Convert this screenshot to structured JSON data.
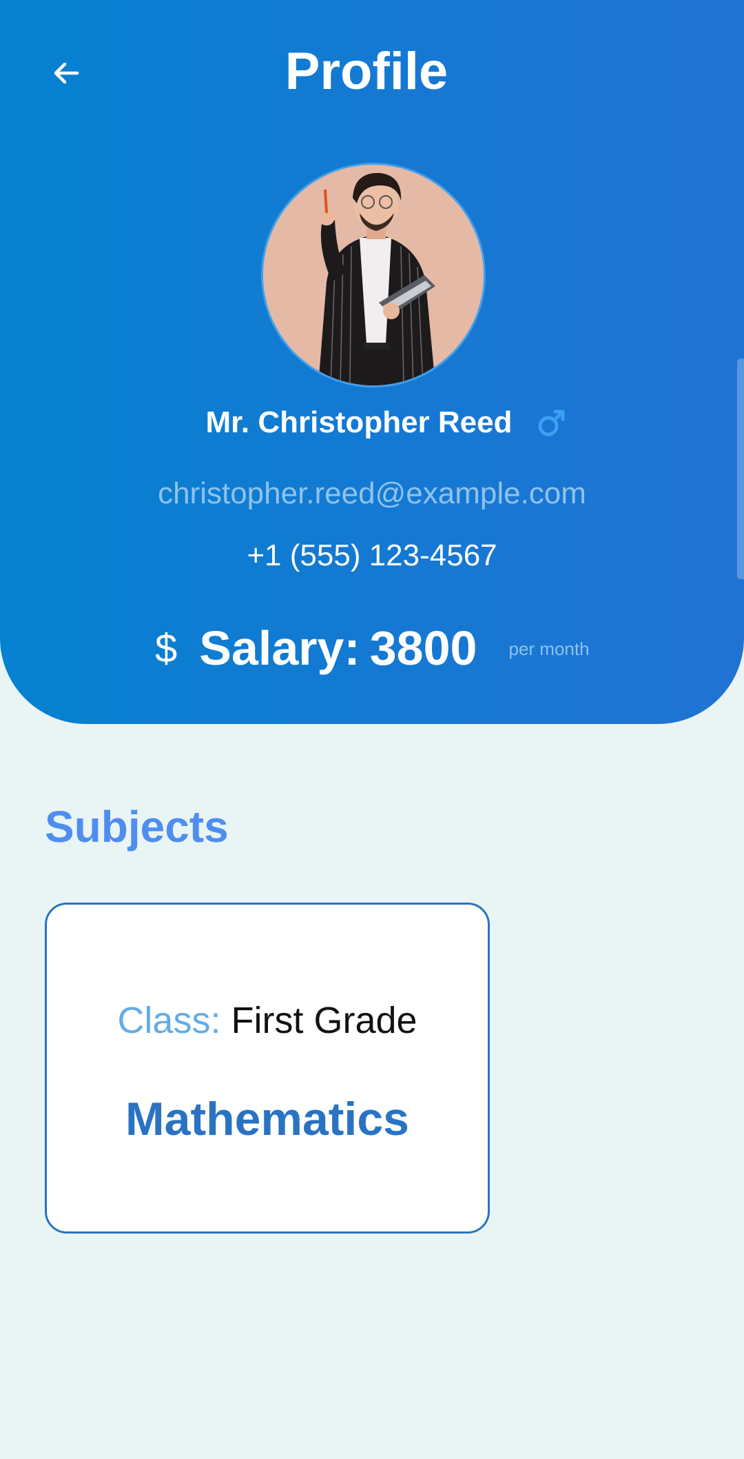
{
  "header": {
    "title": "Profile",
    "back_icon": "arrow-left-icon"
  },
  "profile": {
    "name": "Mr. Christopher Reed",
    "gender_icon": "male-symbol-icon",
    "email": "christopher.reed@example.com",
    "phone": "+1 (555) 123-4567",
    "salary": {
      "currency_symbol": "$",
      "label": "Salary:",
      "value": "3800",
      "period": "per month"
    }
  },
  "subjects": {
    "title": "Subjects",
    "items": [
      {
        "class_label": "Class:",
        "class_value": "First Grade",
        "subject": "Mathematics"
      }
    ]
  },
  "colors": {
    "header_gradient_start": "#0582d0",
    "header_gradient_end": "#2173d3",
    "background": "#e9f5f4",
    "accent_blue": "#4f8ef0",
    "card_border": "#2a73bf",
    "muted_text": "#8ec3ee"
  }
}
